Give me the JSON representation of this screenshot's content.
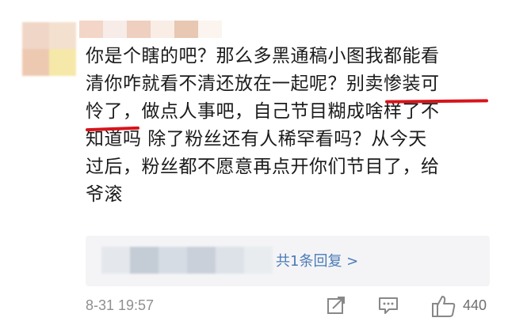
{
  "comment": {
    "lines": [
      "你是个瞎的吧？那么多黑通稿小图我都能看",
      "清你咋就看不清还放在一起呢？别卖惨装可",
      "怜了，做点人事吧，自己节目糊成啥样了不",
      "知道吗 除了粉丝还有人稀罕看吗？从今天",
      "过后，粉丝都不愿意再点开你们节目了，给",
      "爷滚"
    ]
  },
  "replies": {
    "count_label": "共1条回复 >"
  },
  "footer": {
    "timestamp": "8-31 19:57",
    "like_count": "440",
    "icons": [
      "share-icon",
      "comment-icon",
      "like-icon"
    ]
  },
  "colors": {
    "annotation_red": "#d8141b",
    "link_blue": "#4a7bb8",
    "meta_gray": "#8f8f8f",
    "reply_bg": "#f4f4f6"
  }
}
